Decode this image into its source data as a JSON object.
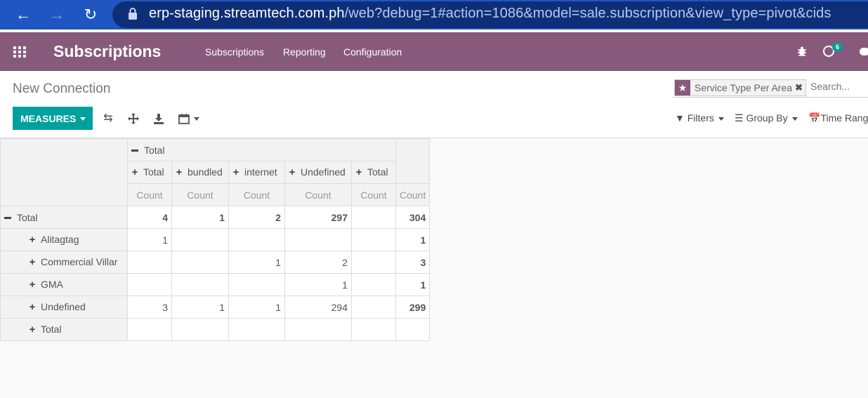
{
  "browser": {
    "url_host": "erp-staging.streamtech.com.ph",
    "url_path": "/web?debug=1#action=1086&model=sale.subscription&view_type=pivot&cids"
  },
  "navbar": {
    "app_name": "Subscriptions",
    "menus": [
      "Subscriptions",
      "Reporting",
      "Configuration"
    ],
    "activity_count": "6"
  },
  "control_panel": {
    "breadcrumb": "New Connection",
    "facet_label": "Service Type Per Area",
    "search_placeholder": "Search...",
    "measures_label": "MEASURES",
    "filters_label": "Filters",
    "groupby_label": "Group By",
    "timerange_label": "Time Rang"
  },
  "pivot": {
    "top_header": "Total",
    "column_groups": [
      "Total",
      "bundled",
      "internet",
      "Undefined",
      "Total"
    ],
    "measure_label": "Count",
    "rows": [
      {
        "label": "Total",
        "expanded": true,
        "values": [
          "4",
          "1",
          "2",
          "297",
          "",
          "304"
        ]
      },
      {
        "label": "Alitagtag",
        "expanded": false,
        "values": [
          "1",
          "",
          "",
          "",
          "",
          "1"
        ]
      },
      {
        "label": "Commercial Villar",
        "expanded": false,
        "values": [
          "",
          "",
          "1",
          "2",
          "",
          "3"
        ]
      },
      {
        "label": "GMA",
        "expanded": false,
        "values": [
          "",
          "",
          "",
          "1",
          "",
          "1"
        ]
      },
      {
        "label": "Undefined",
        "expanded": false,
        "values": [
          "3",
          "1",
          "1",
          "294",
          "",
          "299"
        ]
      },
      {
        "label": "Total",
        "expanded": false,
        "values": [
          "",
          "",
          "",
          "",
          "",
          ""
        ]
      }
    ]
  }
}
